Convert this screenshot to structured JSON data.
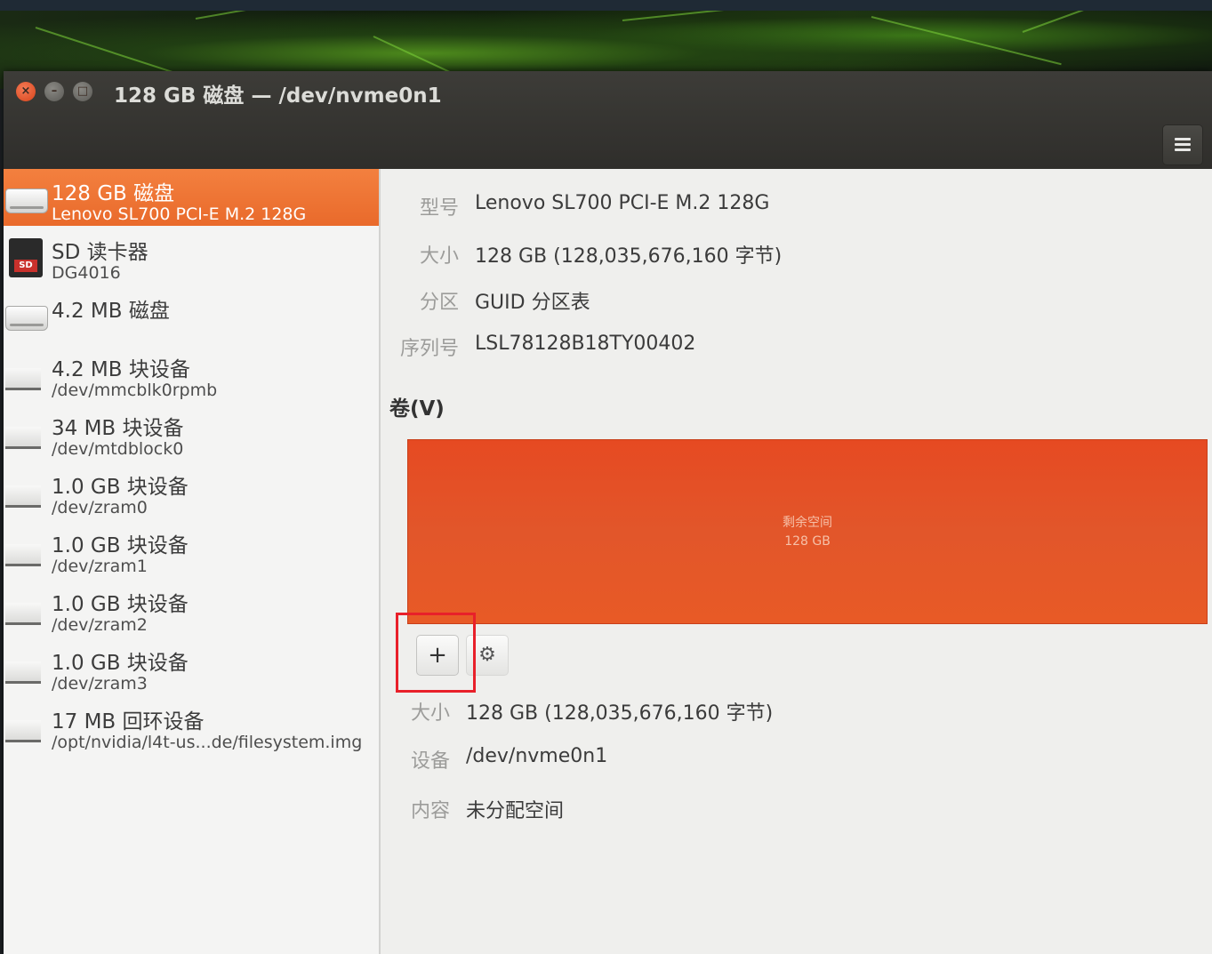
{
  "window": {
    "title": "128 GB 磁盘 — /dev/nvme0n1",
    "close_glyph": "×",
    "min_glyph": "–",
    "max_glyph": "□"
  },
  "devices": [
    {
      "name": "128 GB 磁盘",
      "sub": "Lenovo SL700 PCI-E M.2 128G",
      "icon": "disk-icon",
      "selected": true
    },
    {
      "name": "SD 读卡器",
      "sub": "DG4016",
      "icon": "sd-card-icon",
      "selected": false
    },
    {
      "name": "4.2 MB 磁盘",
      "sub": "",
      "icon": "disk-icon",
      "selected": false
    },
    {
      "name": "4.2 MB 块设备",
      "sub": "/dev/mmcblk0rpmb",
      "icon": "block-device-icon",
      "selected": false
    },
    {
      "name": "34 MB 块设备",
      "sub": "/dev/mtdblock0",
      "icon": "block-device-icon",
      "selected": false
    },
    {
      "name": "1.0 GB 块设备",
      "sub": "/dev/zram0",
      "icon": "block-device-icon",
      "selected": false
    },
    {
      "name": "1.0 GB 块设备",
      "sub": "/dev/zram1",
      "icon": "block-device-icon",
      "selected": false
    },
    {
      "name": "1.0 GB 块设备",
      "sub": "/dev/zram2",
      "icon": "block-device-icon",
      "selected": false
    },
    {
      "name": "1.0 GB 块设备",
      "sub": "/dev/zram3",
      "icon": "block-device-icon",
      "selected": false
    },
    {
      "name": "17 MB 回环设备",
      "sub": "/opt/nvidia/l4t-us...de/filesystem.img",
      "icon": "block-device-icon",
      "selected": false
    }
  ],
  "disk_info": {
    "model_label": "型号",
    "model": "Lenovo SL700 PCI-E M.2 128G",
    "size_label": "大小",
    "size": "128 GB (128,035,676,160 字节)",
    "partition_label": "分区",
    "partition": "GUID 分区表",
    "serial_label": "序列号",
    "serial": "LSL78128B18TY00402"
  },
  "volumes": {
    "label": "卷(V)",
    "segment_title": "剩余空间",
    "segment_size": "128 GB",
    "add_glyph": "+",
    "settings_glyph": "⚙"
  },
  "volume_info": {
    "size_label": "大小",
    "size": "128 GB (128,035,676,160 字节)",
    "device_label": "设备",
    "device": "/dev/nvme0n1",
    "content_label": "内容",
    "content": "未分配空间"
  },
  "colors": {
    "accent": "#e96a2b",
    "volume_bar": "#e64a22",
    "highlight": "#e8202a"
  }
}
